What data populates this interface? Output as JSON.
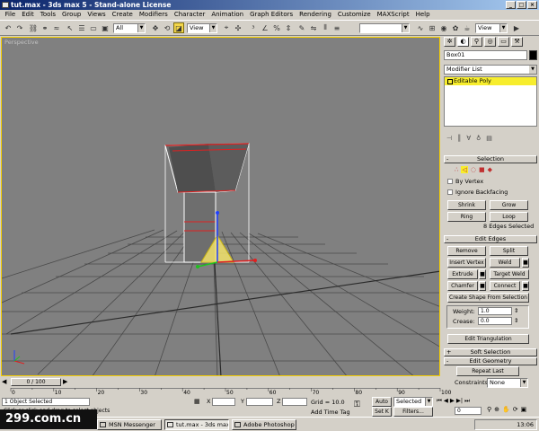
{
  "window": {
    "title": "tut.max - 3ds max 5 - Stand-alone License"
  },
  "menu": [
    "File",
    "Edit",
    "Tools",
    "Group",
    "Views",
    "Create",
    "Modifiers",
    "Character",
    "Animation",
    "Graph Editors",
    "Rendering",
    "Customize",
    "MAXScript",
    "Help"
  ],
  "toolbar": {
    "selection_filter": "All",
    "ref_coord": "View",
    "named_sel": "",
    "render_view": "View"
  },
  "viewport": {
    "label": "Perspective"
  },
  "command_panel": {
    "object_name": "Box01",
    "modifier_list": "Modifier List",
    "stack_item": "Editable Poly",
    "selection": {
      "title": "Selection",
      "by_vertex": "By Vertex",
      "ignore_backfacing": "Ignore Backfacing",
      "shrink": "Shrink",
      "grow": "Grow",
      "ring": "Ring",
      "loop": "Loop",
      "status": "8 Edges Selected"
    },
    "edit_edges": {
      "title": "Edit Edges",
      "remove": "Remove",
      "split": "Split",
      "insert_vertex": "Insert Vertex",
      "weld": "Weld",
      "extrude": "Extrude",
      "target_weld": "Target Weld",
      "chamfer": "Chamfer",
      "connect": "Connect",
      "create_shape": "Create Shape From Selection",
      "weight_label": "Weight:",
      "weight_value": "1.0",
      "crease_label": "Crease:",
      "crease_value": "0.0",
      "edit_tri": "Edit Triangulation"
    },
    "soft_selection": "Soft Selection",
    "edit_geometry": "Edit Geometry",
    "repeat_last": "Repeat Last",
    "constraints_label": "Constraints:",
    "constraints_value": "None"
  },
  "timeline": {
    "slider": "0 / 100",
    "ticks": [
      "0",
      "10",
      "20",
      "30",
      "40",
      "50",
      "60",
      "70",
      "80",
      "90",
      "100"
    ],
    "current_frame": 0,
    "total_frames": 100
  },
  "status": {
    "selected": "1 Object Selected",
    "prompt": "Click or click-and-drag to select objects",
    "x_label": "X",
    "x_value": "",
    "y_label": "Y",
    "y_value": "",
    "z_label": "Z",
    "z_value": "",
    "grid": "Grid = 10.0",
    "add_time_tag": "Add Time Tag",
    "auto": "Auto",
    "set": "Set K",
    "selected_dropdown": "Selected",
    "filters": "Filters...",
    "frame": "0"
  },
  "taskbar": {
    "items": [
      "MSN Messenger",
      "tut.max - 3ds max...",
      "Adobe Photoshop"
    ],
    "clock": "13:06"
  },
  "watermark": "299.com.cn"
}
